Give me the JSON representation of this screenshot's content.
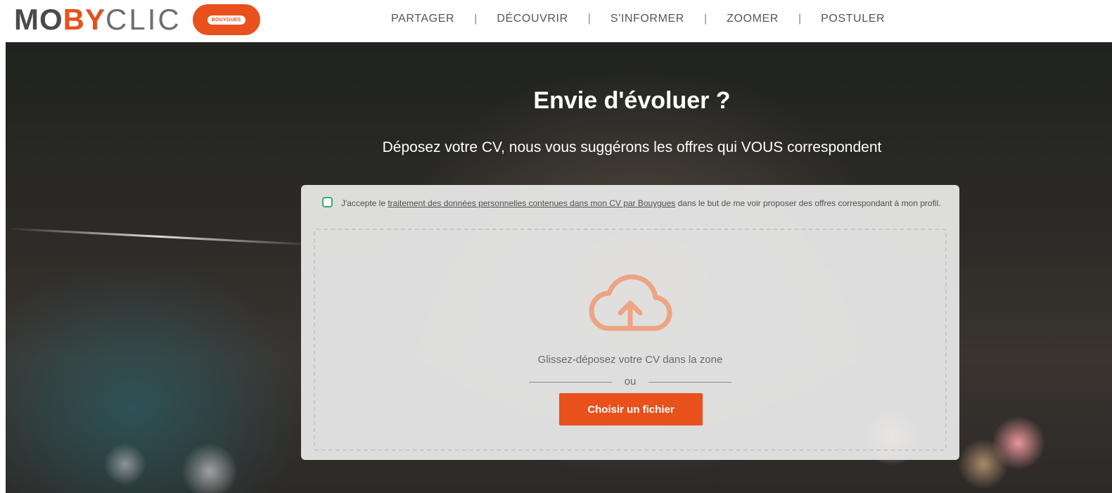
{
  "header": {
    "logo": {
      "part1": "MO",
      "part2": "BY",
      "part3": "CLIC",
      "badge": "BOUYGUES"
    },
    "nav": [
      {
        "label": "PARTAGER"
      },
      {
        "label": "DÉCOUVRIR"
      },
      {
        "label": "S'INFORMER"
      },
      {
        "label": "ZOOMER"
      },
      {
        "label": "POSTULER"
      }
    ],
    "separator": "|"
  },
  "hero": {
    "title": "Envie d'évoluer ?",
    "subtitle": "Déposez votre CV, nous vous suggérons les offres qui VOUS correspondent"
  },
  "upload": {
    "consent_prefix": "J'accepte le ",
    "consent_link": "traitement des données personnelles contenues dans mon CV par Bouygues",
    "consent_suffix": " dans le but de me voir proposer des offres correspondant à mon profil.",
    "consent_checked": false,
    "drop_text": "Glissez-déposez votre CV dans la zone",
    "or_text": "ou",
    "button_label": "Choisir un fichier",
    "icon": "cloud-upload-icon"
  },
  "colors": {
    "brand_orange": "#e8501c",
    "checkbox_green": "#3daa6e",
    "logo_dark": "#4a4a4a"
  }
}
